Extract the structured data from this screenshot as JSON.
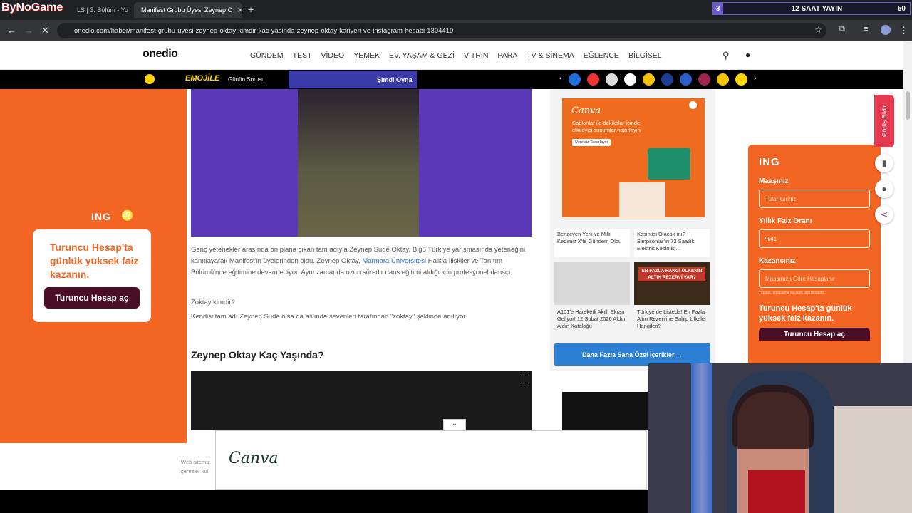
{
  "overlay": {
    "logo": "ByNoGame",
    "stream_counter": "3",
    "stream_title": "12 SAAT YAYIN",
    "viewer_count": "50"
  },
  "tabs": [
    {
      "label": "LS | 3. Bölüm - Yo"
    },
    {
      "label": "Manifest Grubu Üyesi Zeynep O"
    }
  ],
  "url": "onedio.com/haber/manifest-grubu-uyesi-zeynep-oktay-kimdir-kac-yasinda-zeynep-oktay-kariyeri-ve-instagram-hesabi-1304410",
  "site": {
    "logo": "onedio",
    "menu": [
      "GÜNDEM",
      "TEST",
      "VİDEO",
      "YEMEK",
      "EV, YAŞAM & GEZİ",
      "VİTRİN",
      "PARA",
      "TV & SİNEMA",
      "EĞLENCE",
      "BİLGİSEL"
    ]
  },
  "strip": {
    "emojile": "EMOJİLE",
    "gunun_sorusu": "Günün Sorusu",
    "play": "Şimdi Oyna"
  },
  "left_ad": {
    "brand": "ING",
    "headline": "Turuncu Hesap'ta günlük yüksek faiz kazanın.",
    "button": "Turuncu Hesap aç"
  },
  "article": {
    "p1_a": "Genç yetenekler arasında ön plana çıkan tam adıyla Zeynep Sude Oktay, Big5 Türkiye yarışmasında yeteneğini kanıtlayarak Manifest'in üyelerinden oldu. Zeynep Oktay, ",
    "p1_link": "Marmara Üniversitesi",
    "p1_b": " Halkla İlişkiler ve Tanıtım Bölümü'nde eğitimine devam ediyor. Aynı zamanda uzun süredir dans eğitimi aldığı için profesyonel dansçı.",
    "p2": "Zoktay kimdir?",
    "p3": "Kendisi tam adı Zeynep Sude olsa da aslında sevenleri tarafından \"zoktay\" şeklinde anılıyor.",
    "h2": "Zeynep Oktay Kaç Yaşında?"
  },
  "right_ad": {
    "brand": "Canva",
    "text": "Şablonlar ile dakikalar içinde etkileyici sunumlar hazırlayın",
    "button": "Ücretsiz Tasarlayın",
    "cards": [
      {
        "title": "Benzeyen Yerli ve Milli Kedimiz X'te Gündem Oldu"
      },
      {
        "title": "Kesintisi Olacak mı? Simpsonlar'ın 72 Saatlik Elektrik Kesintisi..."
      },
      {
        "title": "A101'e Hareketli Akıllı Ekran Geliyor! 12 Şubat 2026 Aldın Aldın Kataloğu"
      },
      {
        "title": "Türkiye de Listede! En Fazla Altın Rezervine Sahip Ülkeler Hangileri?",
        "banner": "EN FAZLA HANGİ ÜLKENİN ALTIN REZERVİ VAR?"
      }
    ],
    "cta": "Daha Fazla Sana Özel İçerikler →"
  },
  "calc": {
    "brand": "ING",
    "maas_label": "Maaşınız",
    "maas_ph": "Tutar Giriniz",
    "faiz_label": "Yıllık Faiz Oranı",
    "faiz_val": "%41",
    "kazanc_label": "Kazancınız",
    "kazanc_ph": "Maaşınıza Göre Hesaplanır",
    "note": "Yapılan hesaplama yaklaşık brüt hesaptır.",
    "headline": "Turuncu Hesap'ta günlük yüksek faiz kazanın.",
    "button": "Turuncu Hesap aç"
  },
  "feedback": "Görüş Bildir",
  "bottom_ad": {
    "brand": "Canva"
  },
  "footer": {
    "text": "Web sitemiz çerezler kull"
  }
}
